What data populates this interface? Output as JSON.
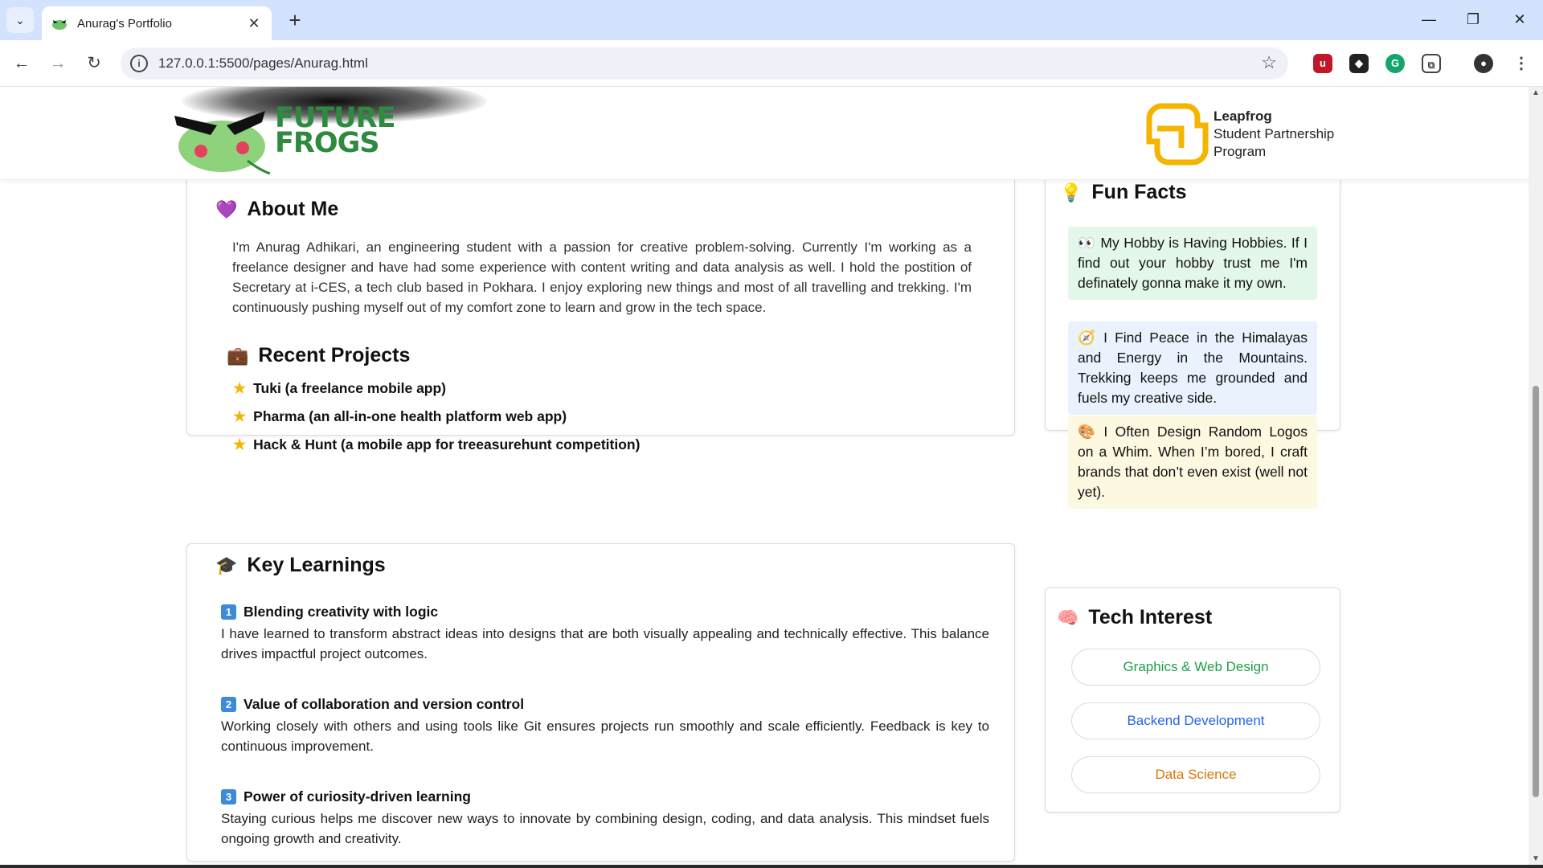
{
  "browser": {
    "tab_title": "Anurag's Portfolio",
    "url": "127.0.0.1:5500/pages/Anurag.html"
  },
  "header": {
    "logo_line1": "FUTURE",
    "logo_line2": "FROGS",
    "partner_line1": "Leapfrog",
    "partner_line2": "Student Partnership",
    "partner_line3": "Program"
  },
  "about": {
    "icon": "💜",
    "title": "About Me",
    "text": "I'm Anurag Adhikari, an engineering student with a passion for creative problem-solving. Currently I'm working as a freelance designer and have had some experience with content writing and data analysis as well. I hold the postition of Secretary at i-CES, a tech club based in Pokhara. I enjoy exploring new things and most of all travelling and trekking. I'm continuously pushing myself out of my comfort zone to learn and grow in the tech space."
  },
  "projects": {
    "icon": "💼",
    "title": "Recent Projects",
    "items": [
      "Tuki (a freelance mobile app)",
      "Pharma (an all-in-one health platform web app)",
      "Hack & Hunt (a mobile app for treeasurehunt competition)"
    ]
  },
  "learnings": {
    "icon": "🎓",
    "title": "Key Learnings",
    "items": [
      {
        "num": "1",
        "title": "Blending creativity with logic",
        "text": "I have learned to transform abstract ideas into designs that are both visually appealing and technically effective. This balance drives impactful project outcomes."
      },
      {
        "num": "2",
        "title": "Value of collaboration and version control",
        "text": "Working closely with others and using tools like Git ensures projects run smoothly and scale efficiently. Feedback is key to continuous improvement."
      },
      {
        "num": "3",
        "title": "Power of curiosity-driven learning",
        "text": "Staying curious helps me discover new ways to innovate by combining design, coding, and data analysis. This mindset fuels ongoing growth and creativity."
      }
    ]
  },
  "fun_facts": {
    "icon": "💡",
    "title": "Fun Facts",
    "items": [
      {
        "emoji": "👀",
        "text": "My Hobby is Having Hobbies. If I find out your hobby trust me I'm definately gonna make it my own.",
        "bg": "#e3f7ea"
      },
      {
        "emoji": "🧭",
        "text": "I Find Peace in the Himalayas and Energy in the Mountains. Trekking keeps me grounded and fuels my creative side.",
        "bg": "#e9f2fd"
      },
      {
        "emoji": "🎨",
        "text": "I Often Design Random Logos on a Whim. When I’m bored, I craft brands that don’t even exist (well not yet).",
        "bg": "#fdf8e0"
      }
    ]
  },
  "tech": {
    "icon": "🧠",
    "title": "Tech Interest",
    "items": [
      {
        "label": "Graphics & Web Design",
        "color": "#1e9e4a"
      },
      {
        "label": "Backend Development",
        "color": "#2563eb"
      },
      {
        "label": "Data Science",
        "color": "#d97706"
      }
    ]
  },
  "colors": {
    "chrome_tab_strip": "#d3e3fd",
    "logo_green": "#2d8a3e",
    "leapfrog_gold": "#f4b400"
  }
}
